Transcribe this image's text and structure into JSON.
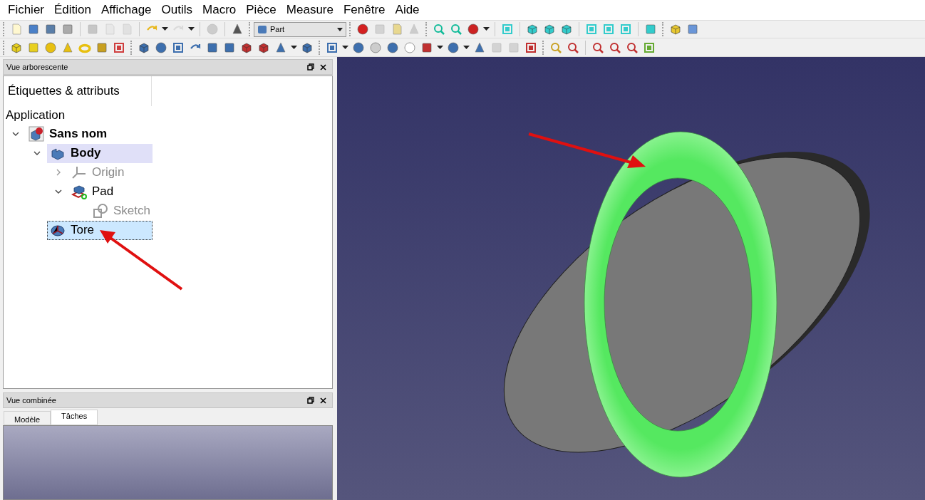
{
  "menu": [
    {
      "label": "Fichier"
    },
    {
      "label": "Édition"
    },
    {
      "label": "Affichage"
    },
    {
      "label": "Outils"
    },
    {
      "label": "Macro"
    },
    {
      "label": "Pièce"
    },
    {
      "label": "Measure"
    },
    {
      "label": "Fenêtre"
    },
    {
      "label": "Aide"
    }
  ],
  "toolbar": {
    "workbench": "Part"
  },
  "tree_panel": {
    "title": "Vue arborescente",
    "column_header": "Étiquettes & attributs",
    "root": "Application",
    "items": [
      {
        "label": "Sans nom",
        "kind": "document",
        "bold": true,
        "active": false,
        "selected": false,
        "hidden": false,
        "expanded": true,
        "children": [
          {
            "label": "Body",
            "kind": "body",
            "bold": true,
            "active": true,
            "selected": false,
            "hidden": false,
            "expanded": true,
            "children": [
              {
                "label": "Origin",
                "kind": "origin",
                "bold": false,
                "active": false,
                "selected": false,
                "hidden": true,
                "expanded": false
              },
              {
                "label": "Pad",
                "kind": "pad",
                "bold": false,
                "active": false,
                "selected": false,
                "hidden": false,
                "expanded": true,
                "children": [
                  {
                    "label": "Sketch",
                    "kind": "sketch",
                    "bold": false,
                    "active": false,
                    "selected": false,
                    "hidden": true
                  }
                ]
              }
            ]
          },
          {
            "label": "Tore",
            "kind": "torus",
            "bold": false,
            "selected": true,
            "hidden": false
          }
        ]
      }
    ]
  },
  "combo_panel": {
    "title": "Vue combinée",
    "tabs": [
      {
        "label": "Modèle",
        "selected": false
      },
      {
        "label": "Tâches",
        "selected": true
      }
    ]
  }
}
